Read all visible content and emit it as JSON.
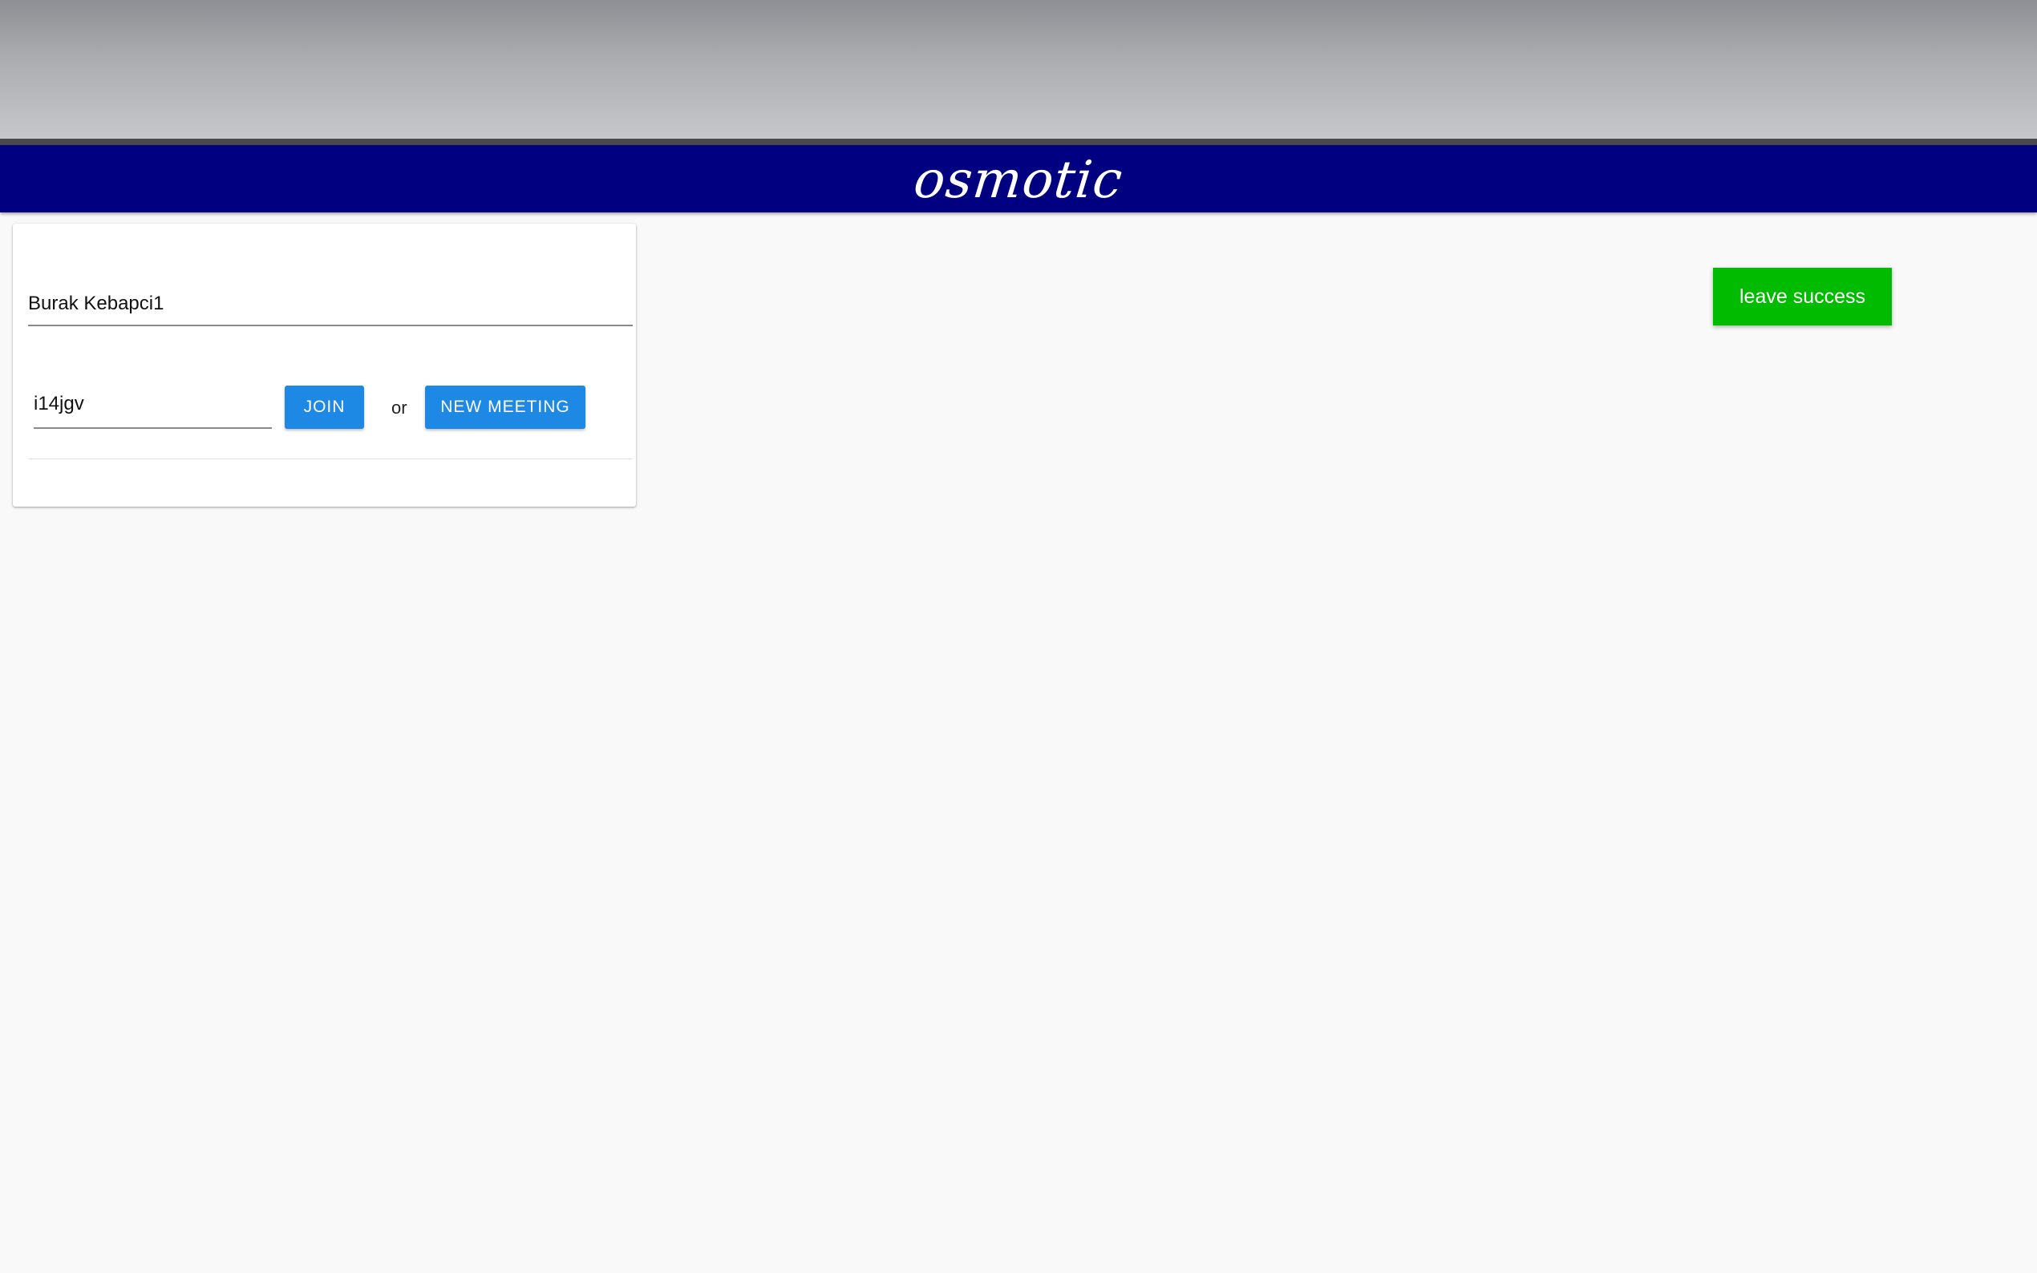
{
  "header": {
    "logo_text": "osmotic",
    "background_color": "#000080"
  },
  "join_form": {
    "name_value": "Burak Kebapci1",
    "room_value": "i14jgv",
    "join_label": "JOIN",
    "or_label": "or",
    "new_meeting_label": "NEW MEETING",
    "button_color": "#1e88e5"
  },
  "notification": {
    "text": "leave success",
    "color": "#00bb00"
  }
}
